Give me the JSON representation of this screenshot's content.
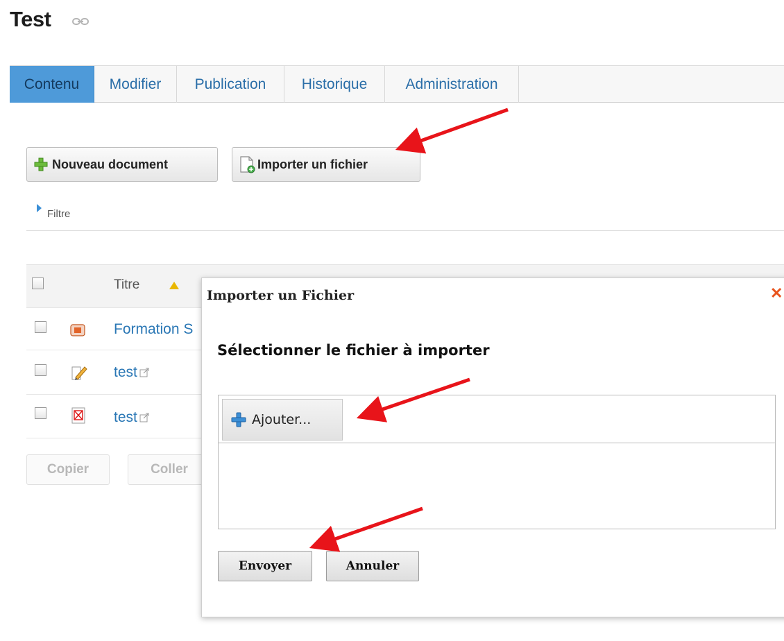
{
  "page": {
    "title": "Test"
  },
  "tabs": [
    {
      "label": "Contenu",
      "active": true
    },
    {
      "label": "Modifier"
    },
    {
      "label": "Publication"
    },
    {
      "label": "Historique"
    },
    {
      "label": "Administration"
    }
  ],
  "toolbar": {
    "new_label": "Nouveau document",
    "import_label": "Importer un fichier"
  },
  "filter": {
    "label": "Filtre"
  },
  "table": {
    "header_title": "Titre",
    "rows": [
      {
        "title": "Formation S",
        "icon": "presentation-icon"
      },
      {
        "title": "test",
        "icon": "pencil-icon"
      },
      {
        "title": "test",
        "icon": "pdf-icon"
      }
    ]
  },
  "bottom_actions": {
    "copy_label": "Copier",
    "paste_label": "Coller"
  },
  "dialog": {
    "title": "Importer un Fichier",
    "close_symbol": "✕",
    "heading": "Sélectionner le fichier à importer",
    "add_label": "Ajouter...",
    "send_label": "Envoyer",
    "cancel_label": "Annuler"
  },
  "colors": {
    "active_tab": "#4e9ad9",
    "link": "#2a77b5",
    "annotation_arrow": "#e8141a",
    "close": "#e8541d"
  }
}
